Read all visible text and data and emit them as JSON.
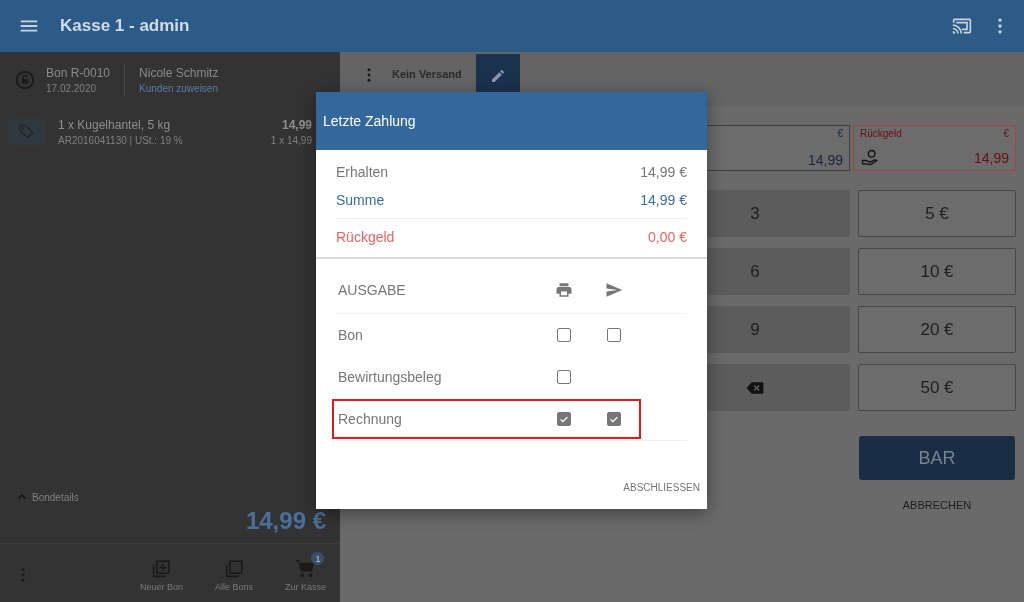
{
  "app_bar": {
    "title": "Kasse 1 - admin"
  },
  "receipt": {
    "number": "Bon R-0010",
    "date": "17.02.2020",
    "customer": "Nicole Schmitz",
    "customer_action": "Kunden zuweisen",
    "items": [
      {
        "name": "1 x Kugelhantel, 5 kg",
        "details": "AR2016041130 | USt.: 19 %",
        "price": "14,99",
        "unit_price": "1 x 14,99"
      }
    ],
    "details_toggle": "Bondetails",
    "total": "14,99 €"
  },
  "bottom_nav": [
    {
      "label": "Neuer Bon",
      "kind": "new"
    },
    {
      "label": "Alle Bons",
      "kind": "all"
    },
    {
      "label": "Zur Kasse",
      "kind": "cart",
      "badge": "1"
    }
  ],
  "shipping": {
    "label": "Kein Versand"
  },
  "payment_fields": [
    {
      "currency": "€",
      "value": "14,99",
      "kind": "given"
    },
    {
      "label": "Rückgeld",
      "currency": "€",
      "value": "14,99",
      "kind": "change"
    }
  ],
  "keypad": [
    {
      "label": "3",
      "kind": "digit"
    },
    {
      "label": "6",
      "kind": "digit"
    },
    {
      "label": "9",
      "kind": "digit"
    },
    {
      "kind": "backspace"
    }
  ],
  "cash_buttons": [
    "5 €",
    "10 €",
    "20 €",
    "50 €"
  ],
  "pay_button": "BAR",
  "cancel_button": "ABBRECHEN",
  "dialog": {
    "title": "Letzte Zahlung",
    "summary": [
      {
        "label": "Erhalten",
        "value": "14,99 €",
        "kind": "received"
      },
      {
        "label": "Summe",
        "value": "14,99 €",
        "kind": "total"
      },
      {
        "label": "Rückgeld",
        "value": "0,00 €",
        "kind": "change"
      }
    ],
    "output_heading": "AUSGABE",
    "outputs": [
      {
        "label": "Bon",
        "print_checked": false,
        "send_checked": false,
        "highlighted": false
      },
      {
        "label": "Bewirtungsbeleg",
        "print_checked": false,
        "highlighted": false
      },
      {
        "label": "Rechnung",
        "print_checked": true,
        "send_checked": true,
        "highlighted": true
      }
    ],
    "confirm": "ABSCHLIESSEN"
  }
}
